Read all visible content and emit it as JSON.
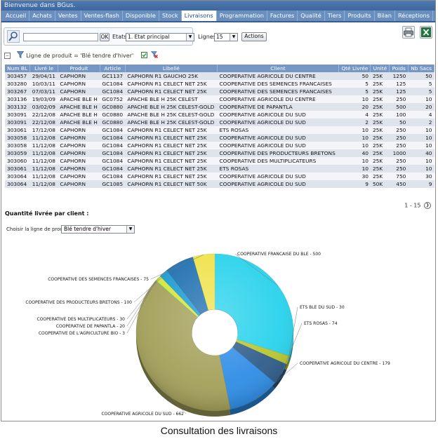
{
  "welcome": "Bienvenue dans BGus.",
  "nav": [
    "Accueil",
    "Achats",
    "Ventes",
    "Ventes-flash",
    "Disponible",
    "Stock",
    "Livraisons",
    "Programmation",
    "Factures",
    "Qualité",
    "Tiers",
    "Produits",
    "Bilan",
    "Réceptions"
  ],
  "nav_active": "Livraisons",
  "toolbar": {
    "ok_label": "OK",
    "etats_label": "Etats",
    "etats_value": "1. Etat principal",
    "lignes_label": "Lignes",
    "lignes_value": "15",
    "actions_label": "Actions"
  },
  "filter": {
    "text": "Ligne de produit = 'Blé tendre d'hiver'"
  },
  "table": {
    "headers": [
      "Num BL",
      "Livré le",
      "Produit",
      "Article",
      "Libellé",
      "Client",
      "Qté Livrée",
      "Unité",
      "Poids",
      "Nb Sacs"
    ],
    "rows": [
      [
        "303457",
        "29/04/11",
        "CAPHORN",
        "GC1137",
        "CAPHORN R1 GAUCHO 25K",
        "COOPERATIVE AGRICOLE DU CENTRE",
        "50",
        "25K",
        "1250",
        "50"
      ],
      [
        "303280",
        "10/03/11",
        "CAPHORN",
        "GC1084",
        "CAPHORN R1 CELECT NET 25K",
        "COOPERATIVE DES SEMENCES FRANCAISES",
        "5",
        "25K",
        "125",
        "5"
      ],
      [
        "303267",
        "07/03/11",
        "CAPHORN",
        "GC1084",
        "CAPHORN R1 CELECT NET 25K",
        "COOPERATIVE DES SEMENCES FRANCAISES",
        "5",
        "25K",
        "125",
        "5"
      ],
      [
        "303136",
        "19/03/09",
        "APACHE BLE H",
        "GC0752",
        "APACHE BLE H 25K CELEST",
        "COOPERATIVE AGRICOLE DU CENTRE",
        "10",
        "25K",
        "250",
        "10"
      ],
      [
        "303132",
        "03/02/09",
        "APACHE BLE H",
        "GC0880",
        "APACHE BLE H 25K CELEST-GOLD",
        "COOPERATIVE DE PAPANTLA",
        "20",
        "25K",
        "500",
        "20"
      ],
      [
        "303091",
        "22/12/08",
        "APACHE BLE H",
        "GC0880",
        "APACHE BLE H 25K CELEST-GOLD",
        "COOPERATIVE AGRICOLE DU SUD",
        "4",
        "25K",
        "100",
        "4"
      ],
      [
        "303091",
        "22/12/08",
        "APACHE BLE H",
        "GC0880",
        "APACHE BLE H 25K CELEST-GOLD",
        "COOPERATIVE AGRICOLE DU SUD",
        "2",
        "25K",
        "50",
        "2"
      ],
      [
        "303061",
        "17/12/08",
        "CAPHORN",
        "GC1084",
        "CAPHORN R1 CELECT NET 25K",
        "ETS ROSAS",
        "10",
        "25K",
        "250",
        "10"
      ],
      [
        "303058",
        "11/12/08",
        "CAPHORN",
        "GC1084",
        "CAPHORN R1 CELECT NET 25K",
        "COOPERATIVE AGRICOLE DU SUD",
        "10",
        "25K",
        "250",
        "10"
      ],
      [
        "303058",
        "11/12/08",
        "CAPHORN",
        "GC1084",
        "CAPHORN R1 CELECT NET 25K",
        "COOPERATIVE AGRICOLE DU SUD",
        "10",
        "25K",
        "250",
        "10"
      ],
      [
        "303059",
        "11/12/08",
        "CAPHORN",
        "GC1084",
        "CAPHORN R1 CELECT NET 25K",
        "COOPERATIVE DES PRODUCTEURS BRETONS",
        "40",
        "25K",
        "1000",
        "40"
      ],
      [
        "303060",
        "11/12/08",
        "CAPHORN",
        "GC1084",
        "CAPHORN R1 CELECT NET 25K",
        "COOPERATIVE DES MULTIPLICATEURS",
        "10",
        "25K",
        "250",
        "10"
      ],
      [
        "303061",
        "11/12/08",
        "CAPHORN",
        "GC1084",
        "CAPHORN R1 CELECT NET 25K",
        "ETS ROSAS",
        "10",
        "25K",
        "250",
        "10"
      ],
      [
        "303064",
        "11/12/08",
        "CAPHORN",
        "GC1084",
        "CAPHORN R1 CELECT NET 25K",
        "COOPERATIVE AGRICOLE DU SUD",
        "30",
        "25K",
        "750",
        "30"
      ],
      [
        "303064",
        "11/12/08",
        "CAPHORN",
        "GC1085",
        "CAPHORN R1 CELECT NET 50K",
        "COOPERATIVE AGRICOLE DU SUD",
        "9",
        "50K",
        "450",
        "9"
      ]
    ]
  },
  "pager": {
    "text": "1 - 15"
  },
  "section_title": "Quantité livrée par client :",
  "chooser": {
    "label": "Choisir la ligne de produit :",
    "value": "Blé tendre d'hiver"
  },
  "caption": "Consultation des livraisons",
  "colors": {
    "nav_bg": "#6a8fbf",
    "header_bg": "#7696c4",
    "row_odd": "#dfe4ec",
    "row_even": "#f3f5f9"
  },
  "icons": [
    "search-icon",
    "funnel-icon",
    "checkbox-icon",
    "clear-filter-icon",
    "print-icon",
    "excel-icon"
  ],
  "chart_data": {
    "type": "pie",
    "donut": true,
    "title": "",
    "slices": [
      {
        "label": "COOPERATIVE FRANCAISE DU BLE - 500",
        "value": 500,
        "color": "#28d2ec"
      },
      {
        "label": "ETS BLE DU SUD - 30",
        "value": 30,
        "color": "#b8c630"
      },
      {
        "label": "ETS ROSAS - 74",
        "value": 74,
        "color": "#2f5d8a"
      },
      {
        "label": "COOPERATIVE AGRICOLE DU CENTRE - 179",
        "value": 179,
        "color": "#2f8de6"
      },
      {
        "label": "COOPERATIVE AGRICOLE DU SUD - 662",
        "value": 662,
        "color": "#a4a05a"
      },
      {
        "label": "COOPERATIVE DE L'AGRICULTURE BIO - 3",
        "value": 3,
        "color": "#7ec96a"
      },
      {
        "label": "COOPERATIVE DE PAPANTLA - 20",
        "value": 20,
        "color": "#d4e63a"
      },
      {
        "label": "COOPERATIVE DES MULTIPLICATEURS - 30",
        "value": 30,
        "color": "#1c9bd2"
      },
      {
        "label": "COOPERATIVE DES PRODUCTEURS BRETONS - 100",
        "value": 100,
        "color": "#1f6fb0"
      },
      {
        "label": "COOPERATIVE DES SEMENCES FRANCAISES - 75",
        "value": 75,
        "color": "#f0e24a"
      }
    ]
  }
}
